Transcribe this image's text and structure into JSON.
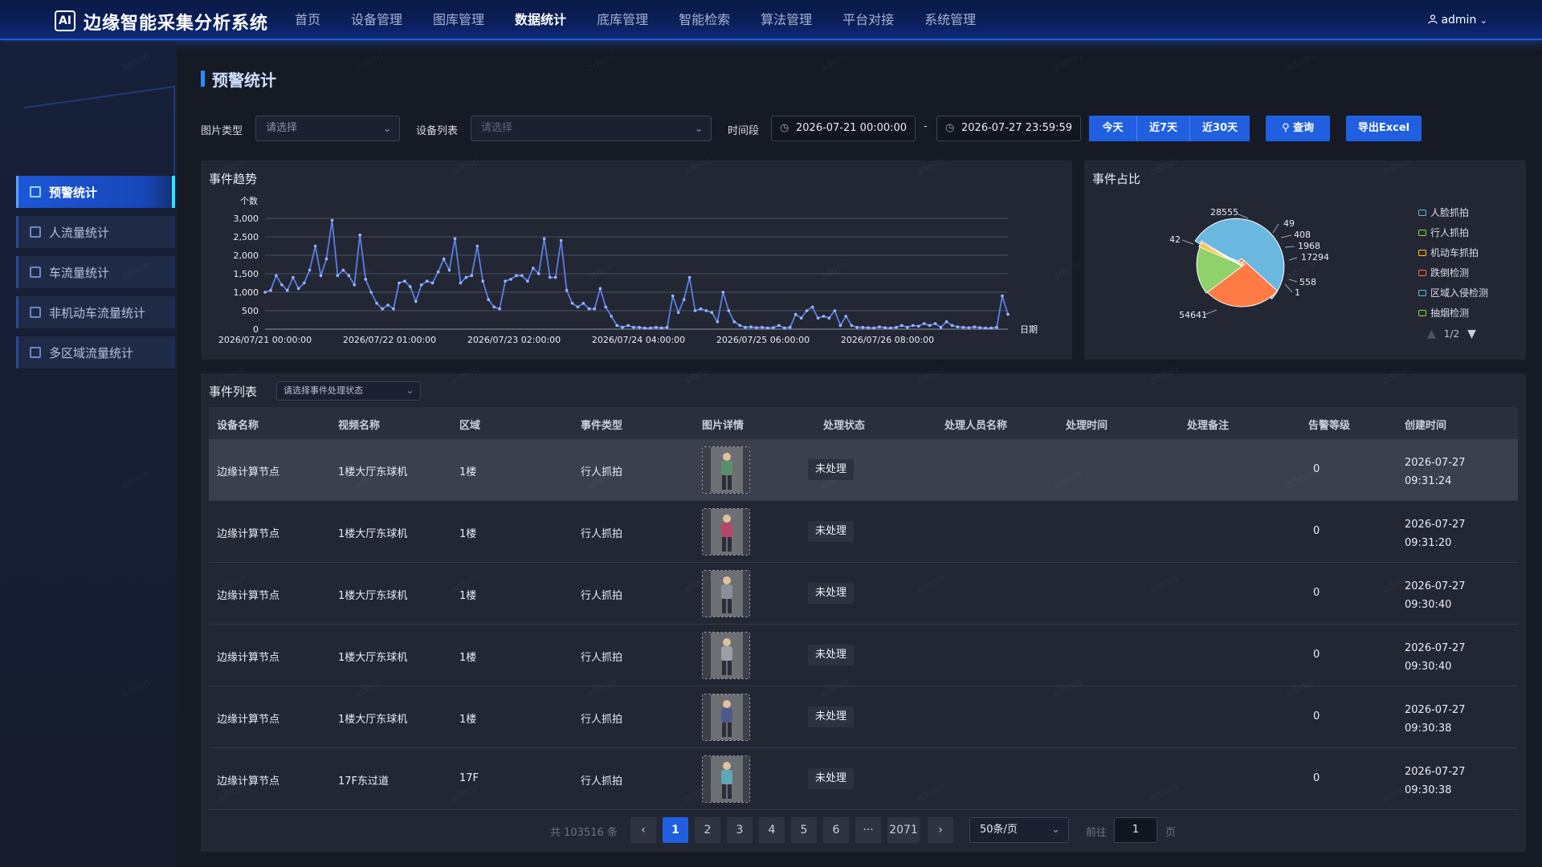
{
  "app": {
    "logo_text": "AI",
    "title": "边缘智能采集分析系统",
    "user": "admin"
  },
  "nav": [
    "首页",
    "设备管理",
    "图库管理",
    "数据统计",
    "底库管理",
    "智能检索",
    "算法管理",
    "平台对接",
    "系统管理"
  ],
  "sidebar": [
    "预警统计",
    "人流量统计",
    "车流量统计",
    "非机动车流量统计",
    "多区域流量统计"
  ],
  "page_title": "预警统计",
  "filters": {
    "image_type_label": "图片类型",
    "image_type_value": "请选择",
    "device_label": "设备列表",
    "device_placeholder": "请选择",
    "time_label": "时间段",
    "start": "2026-07-21 00:00:00",
    "sep": "-",
    "end": "2026-07-27 23:59:59",
    "today": "今天",
    "last7": "近7天",
    "last30": "近30天",
    "query": "查询",
    "export": "导出Excel"
  },
  "trend": {
    "title": "事件趋势",
    "ylabel": "个数",
    "xlabel": "日期",
    "yticks": [
      "3,000",
      "2,500",
      "2,000",
      "1,500",
      "1,000",
      "500",
      "0"
    ],
    "xticks": [
      "2026/07/21 00:00:00",
      "2026/07/22 01:00:00",
      "2026/07/23 02:00:00",
      "2026/07/24 04:00:00",
      "2026/07/25 06:00:00",
      "2026/07/26 08:00:00"
    ]
  },
  "ratio": {
    "title": "事件占比",
    "legend": [
      "人脸抓拍",
      "行人抓拍",
      "机动车抓拍",
      "跌倒检测",
      "区域入侵检测",
      "抽烟检测"
    ],
    "page": "1/2",
    "labels": [
      "28555",
      "49",
      "408",
      "1968",
      "17294",
      "558",
      "1",
      "42",
      "54641"
    ]
  },
  "chart_data": [
    {
      "type": "line",
      "title": "事件趋势",
      "xlabel": "日期",
      "ylabel": "个数",
      "ylim": [
        0,
        3000
      ],
      "x_ticks": [
        "2026/07/21 00:00:00",
        "2026/07/22 01:00:00",
        "2026/07/23 02:00:00",
        "2026/07/24 04:00:00",
        "2026/07/25 06:00:00",
        "2026/07/26 08:00:00"
      ],
      "values": [
        1000,
        1050,
        1450,
        1200,
        1050,
        1400,
        1100,
        1250,
        1600,
        2250,
        1450,
        1900,
        2950,
        1450,
        1600,
        1450,
        1200,
        2550,
        1350,
        1000,
        700,
        550,
        650,
        550,
        1250,
        1300,
        1150,
        750,
        1200,
        1300,
        1250,
        1550,
        1900,
        1600,
        2450,
        1250,
        1400,
        1450,
        2250,
        1300,
        800,
        600,
        550,
        1300,
        1350,
        1450,
        1450,
        1300,
        1650,
        1500,
        2450,
        1400,
        1400,
        2400,
        1050,
        700,
        600,
        700,
        550,
        550,
        1100,
        600,
        350,
        100,
        50,
        100,
        50,
        50,
        30,
        30,
        50,
        30,
        50,
        900,
        450,
        800,
        1400,
        500,
        550,
        500,
        450,
        200,
        1000,
        500,
        200,
        100,
        50,
        60,
        40,
        50,
        30,
        40,
        100,
        30,
        50,
        400,
        300,
        500,
        600,
        300,
        350,
        300,
        500,
        100,
        350,
        100,
        50,
        50,
        40,
        30,
        60,
        40,
        30,
        50,
        100,
        50,
        100,
        80,
        150,
        100,
        150,
        50,
        200,
        100,
        60,
        50,
        40,
        60,
        40,
        30,
        30,
        50,
        900,
        400
      ]
    },
    {
      "type": "pie",
      "title": "事件占比",
      "categories": [
        "人脸抓拍",
        "行人抓拍",
        "机动车抓拍",
        "跌倒检测",
        "区域入侵检测",
        "抽烟检测"
      ],
      "values": [
        54641,
        17294,
        28555,
        408,
        1968,
        558
      ],
      "other_labels": [
        "49",
        "1",
        "42"
      ]
    }
  ],
  "events": {
    "title": "事件列表",
    "status_placeholder": "请选择事件处理状态",
    "columns": [
      "设备名称",
      "视频名称",
      "区域",
      "事件类型",
      "图片详情",
      "处理状态",
      "处理人员名称",
      "处理时间",
      "处理备注",
      "告警等级",
      "创建时间"
    ],
    "rows": [
      {
        "device": "边缘计算节点",
        "video": "1楼大厅东球机",
        "area": "1楼",
        "type": "行人抓拍",
        "status": "未处理",
        "level": "0",
        "date": "2026-07-27",
        "time": "09:31:24"
      },
      {
        "device": "边缘计算节点",
        "video": "1楼大厅东球机",
        "area": "1楼",
        "type": "行人抓拍",
        "status": "未处理",
        "level": "0",
        "date": "2026-07-27",
        "time": "09:31:20"
      },
      {
        "device": "边缘计算节点",
        "video": "1楼大厅东球机",
        "area": "1楼",
        "type": "行人抓拍",
        "status": "未处理",
        "level": "0",
        "date": "2026-07-27",
        "time": "09:30:40"
      },
      {
        "device": "边缘计算节点",
        "video": "1楼大厅东球机",
        "area": "1楼",
        "type": "行人抓拍",
        "status": "未处理",
        "level": "0",
        "date": "2026-07-27",
        "time": "09:30:40"
      },
      {
        "device": "边缘计算节点",
        "video": "1楼大厅东球机",
        "area": "1楼",
        "type": "行人抓拍",
        "status": "未处理",
        "level": "0",
        "date": "2026-07-27",
        "time": "09:30:38"
      },
      {
        "device": "边缘计算节点",
        "video": "17F东过道",
        "area": "17F",
        "type": "行人抓拍",
        "status": "未处理",
        "level": "0",
        "date": "2026-07-27",
        "time": "09:30:38"
      }
    ]
  },
  "pagination": {
    "total": "共 103516 条",
    "prev": "‹",
    "next": "›",
    "pages": [
      "1",
      "2",
      "3",
      "4",
      "5",
      "6",
      "···",
      "2071"
    ],
    "page_size": "50条/页",
    "goto_label": "前往",
    "goto_value": "1",
    "goto_suffix": "页"
  },
  "watermark": "admin",
  "colors": {
    "accent": "#1f5fe0",
    "line": "#5b7ee5",
    "pie_blue": "#6ab7df",
    "pie_orange": "#ff7a45",
    "pie_green": "#8fd16a"
  }
}
